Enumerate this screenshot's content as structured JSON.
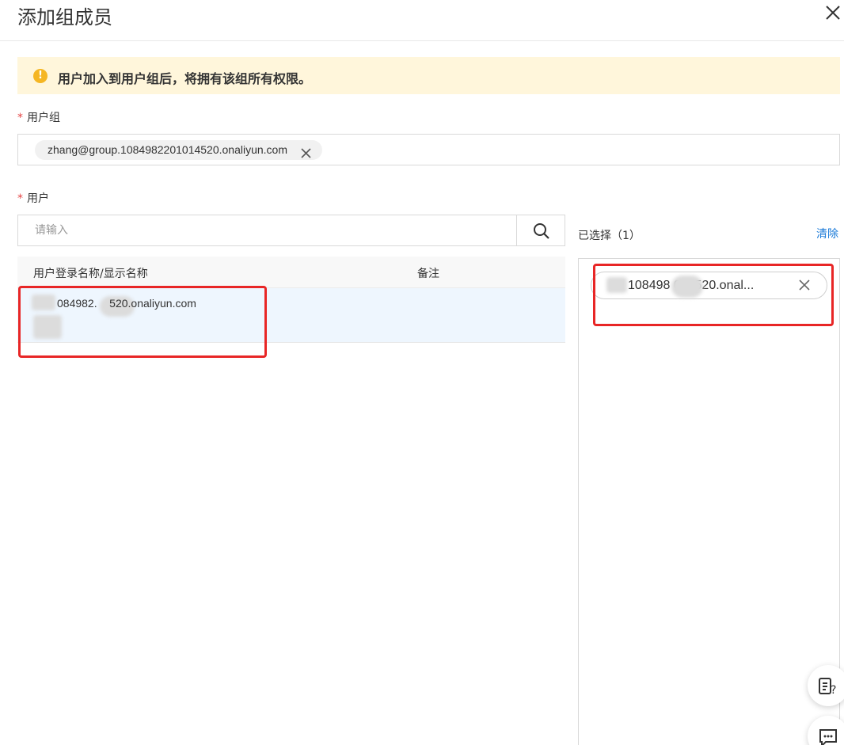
{
  "dialog": {
    "title": "添加组成员"
  },
  "alert": {
    "icon_glyph": "!",
    "icon_name": "warning-icon",
    "message": "用户加入到用户组后，将拥有该组所有权限。",
    "color": "#fff6db"
  },
  "group_field": {
    "required_mark": "*",
    "label": "用户组",
    "selected_tag": "zhang@group.1084982201014520.onaliyun.com"
  },
  "user_field": {
    "required_mark": "*",
    "label": "用户",
    "search_placeholder": "请输入",
    "columns": [
      "用户登录名称/显示名称",
      "备注"
    ],
    "rows": [
      {
        "login_name": "084982.    520.onaliyun.com",
        "display_name": "...",
        "note": ""
      }
    ]
  },
  "selected": {
    "label": "已选择（1）",
    "clear_label": "清除",
    "items": [
      {
        "text": "108498    014520.onal..."
      }
    ]
  },
  "colors": {
    "accent": "#1a7ad8",
    "required": "#e54545",
    "highlight": "#e82626",
    "warning": "#f5b623"
  }
}
